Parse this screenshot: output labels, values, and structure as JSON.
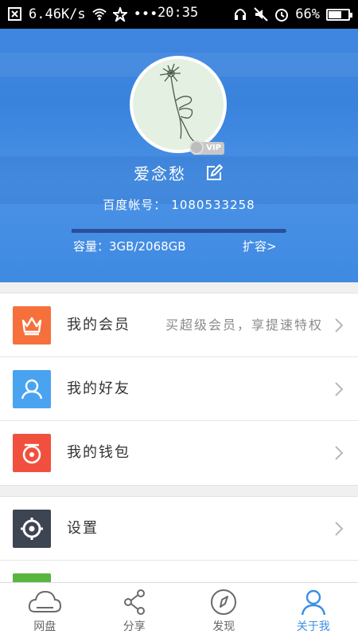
{
  "status_bar": {
    "net_speed": "6.46K/s",
    "dots": "•••",
    "time": "20:35",
    "battery_text": "66%",
    "battery_level": 0.66
  },
  "profile": {
    "username": "爱念愁",
    "vip_label": "VIP",
    "account_label": "百度帐号：",
    "account_id": "1080533258",
    "capacity_text": "容量：3GB/2068GB",
    "capacity_used_fraction": 0.0015,
    "expand_text": "扩容>"
  },
  "menu": {
    "group1": [
      {
        "label": "我的会员",
        "sub": "买超级会员，享提速特权",
        "icon": "crown-icon",
        "color": "#f5703a"
      },
      {
        "label": "我的好友",
        "sub": "",
        "icon": "person-icon",
        "color": "#4aa3f0"
      },
      {
        "label": "我的钱包",
        "sub": "",
        "icon": "wallet-icon",
        "color": "#f1503f"
      }
    ],
    "group2": [
      {
        "label": "设置",
        "sub": "",
        "icon": "gear-icon",
        "color": "#3d4553"
      },
      {
        "label": "",
        "sub": "",
        "icon": "app-icon",
        "color": "#58b540"
      }
    ]
  },
  "tabbar": {
    "tabs": [
      {
        "label": "网盘",
        "icon": "cloud-icon"
      },
      {
        "label": "分享",
        "icon": "share-icon"
      },
      {
        "label": "发现",
        "icon": "compass-icon"
      },
      {
        "label": "关于我",
        "icon": "user-icon"
      }
    ],
    "active_color": "#3a8fe6",
    "inactive_color": "#6a6a6a"
  }
}
